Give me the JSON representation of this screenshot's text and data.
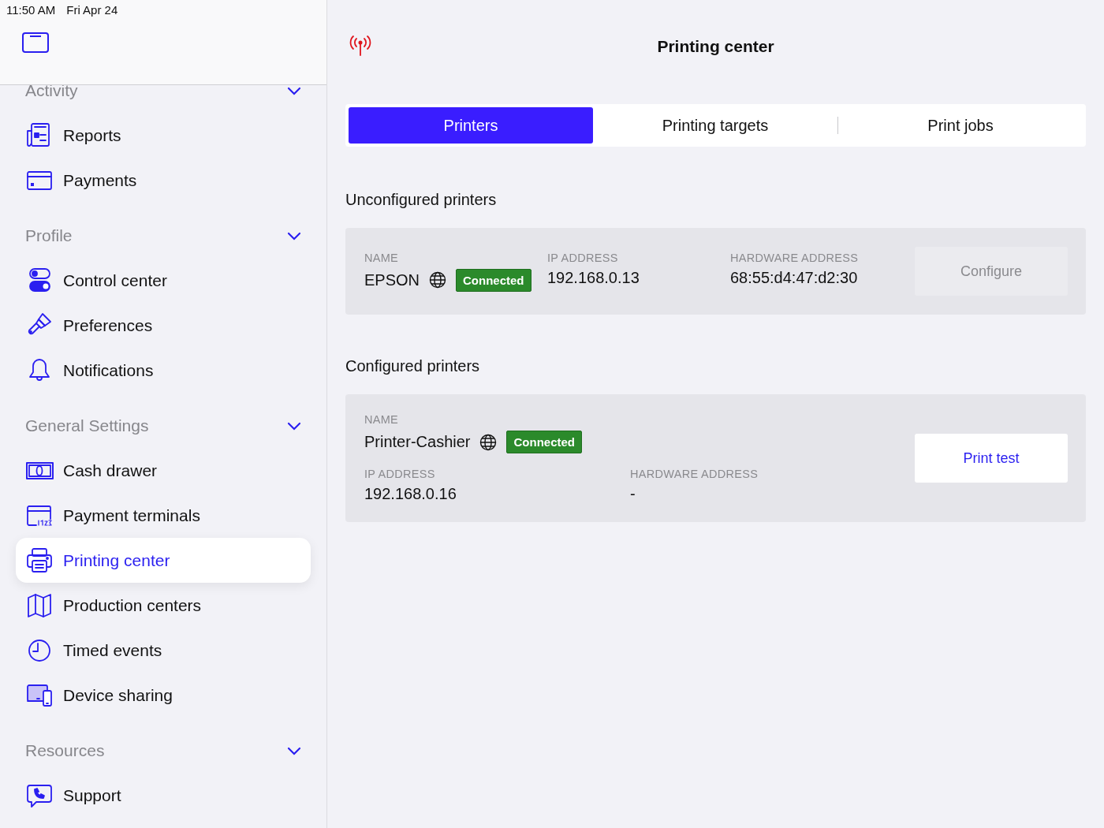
{
  "status_bar": {
    "time": "11:50 AM",
    "date": "Fri Apr 24"
  },
  "sidebar": {
    "sections": [
      {
        "title": "Activity",
        "items": [
          {
            "label": "Reports",
            "selected": false
          },
          {
            "label": "Payments",
            "selected": false
          }
        ]
      },
      {
        "title": "Profile",
        "items": [
          {
            "label": "Control center",
            "selected": false
          },
          {
            "label": "Preferences",
            "selected": false
          },
          {
            "label": "Notifications",
            "selected": false
          }
        ]
      },
      {
        "title": "General Settings",
        "items": [
          {
            "label": "Cash drawer",
            "selected": false
          },
          {
            "label": "Payment terminals",
            "selected": false
          },
          {
            "label": "Printing center",
            "selected": true
          },
          {
            "label": "Production centers",
            "selected": false
          },
          {
            "label": "Timed events",
            "selected": false
          },
          {
            "label": "Device sharing",
            "selected": false
          }
        ]
      },
      {
        "title": "Resources",
        "items": [
          {
            "label": "Support",
            "selected": false
          }
        ]
      }
    ]
  },
  "main": {
    "title": "Printing center",
    "tabs": [
      {
        "label": "Printers",
        "selected": true
      },
      {
        "label": "Printing targets",
        "selected": false
      },
      {
        "label": "Print jobs",
        "selected": false
      }
    ],
    "sections": [
      {
        "title": "Unconfigured printers",
        "printers": [
          {
            "kind": "inline",
            "name_label": "NAME",
            "name": "EPSON",
            "status": "Connected",
            "ip_label": "IP ADDRESS",
            "ip": "192.168.0.13",
            "hw_label": "HARDWARE ADDRESS",
            "hw": "68:55:d4:47:d2:30",
            "action": {
              "label": "Configure",
              "disabled": true
            }
          }
        ]
      },
      {
        "title": "Configured printers",
        "printers": [
          {
            "kind": "stacked",
            "name_label": "NAME",
            "name": "Printer-Cashier",
            "status": "Connected",
            "ip_label": "IP ADDRESS",
            "ip": "192.168.0.16",
            "hw_label": "HARDWARE ADDRESS",
            "hw": "-",
            "action": {
              "label": "Print test",
              "disabled": false
            }
          }
        ]
      }
    ]
  }
}
